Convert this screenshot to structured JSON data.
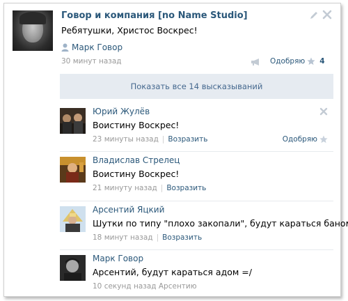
{
  "post": {
    "author": "Говор и компания [no Name Studio]",
    "text": "Ребятушки, Христос Воскрес!",
    "signer": "Марк Говор",
    "time": "30 минут назад",
    "like_label": "Одобряю",
    "like_count": "4"
  },
  "show_all": "Показать все 14 высказываний",
  "comments": [
    {
      "author": "Юрий Жулёв",
      "text": "Воистину Воскрес!",
      "time": "23 минуты назад",
      "reply": "Возразить",
      "like_label": "Одобряю"
    },
    {
      "author": "Владислав Стрелец",
      "text": "Воистину Воскрес!",
      "time": "21 минуту назад",
      "reply": "Возразить"
    },
    {
      "author": "Арсентий Яцкий",
      "text": "Шутки по типу \"плохо закопали\", будут караться баном?",
      "time": "18 минут назад",
      "reply": "Возразить"
    },
    {
      "author": "Марк Говор",
      "text": "Арсентий, будут караться адом =/",
      "time": "10 секунд назад Арсентию"
    }
  ],
  "colors": {
    "link": "#2b587a",
    "meta": "#999999",
    "show_all_bg": "#e6ebf1",
    "icon": "#c3cbd4"
  },
  "icons": [
    "user-icon",
    "edit-icon",
    "close-icon",
    "megaphone-icon",
    "star-icon"
  ]
}
